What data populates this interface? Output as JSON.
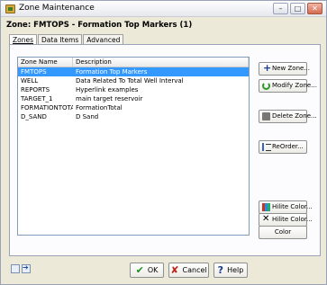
{
  "window": {
    "title": "Zone Maintenance",
    "buttons": {
      "minimize": "–",
      "maximize": "□",
      "close": "✕"
    }
  },
  "heading": "Zone: FMTOPS - Formation Top Markers     (1)",
  "tabs": [
    "Zones",
    "Data Items",
    "Advanced"
  ],
  "list": {
    "columns": [
      "Zone Name",
      "Description"
    ],
    "rows": [
      {
        "name": "FMTOPS",
        "desc": "Formation Top Markers",
        "selected": true
      },
      {
        "name": "WELL",
        "desc": "Data Related To Total Well Interval"
      },
      {
        "name": "REPORTS",
        "desc": "Hyperlink examples"
      },
      {
        "name": "TARGET_1",
        "desc": "main target reservoir"
      },
      {
        "name": "FORMATIONTOTAL",
        "desc": "FormationTotal"
      },
      {
        "name": "D_SAND",
        "desc": "D Sand"
      }
    ]
  },
  "side_buttons": {
    "new_zone": "New Zone...",
    "modify_zone": "Modify Zone...",
    "delete_zone": "Delete Zone...",
    "reorder": "ReOrder...",
    "hilite_color_1": "Hilite Color...",
    "hilite_color_2": "Hilite Color...",
    "color": "Color"
  },
  "dialog_buttons": {
    "ok": "OK",
    "cancel": "Cancel",
    "help": "Help"
  },
  "colors": {
    "selection": "#3399ff",
    "ok_icon": "#1e8e1e",
    "cancel_icon": "#c0261d"
  }
}
